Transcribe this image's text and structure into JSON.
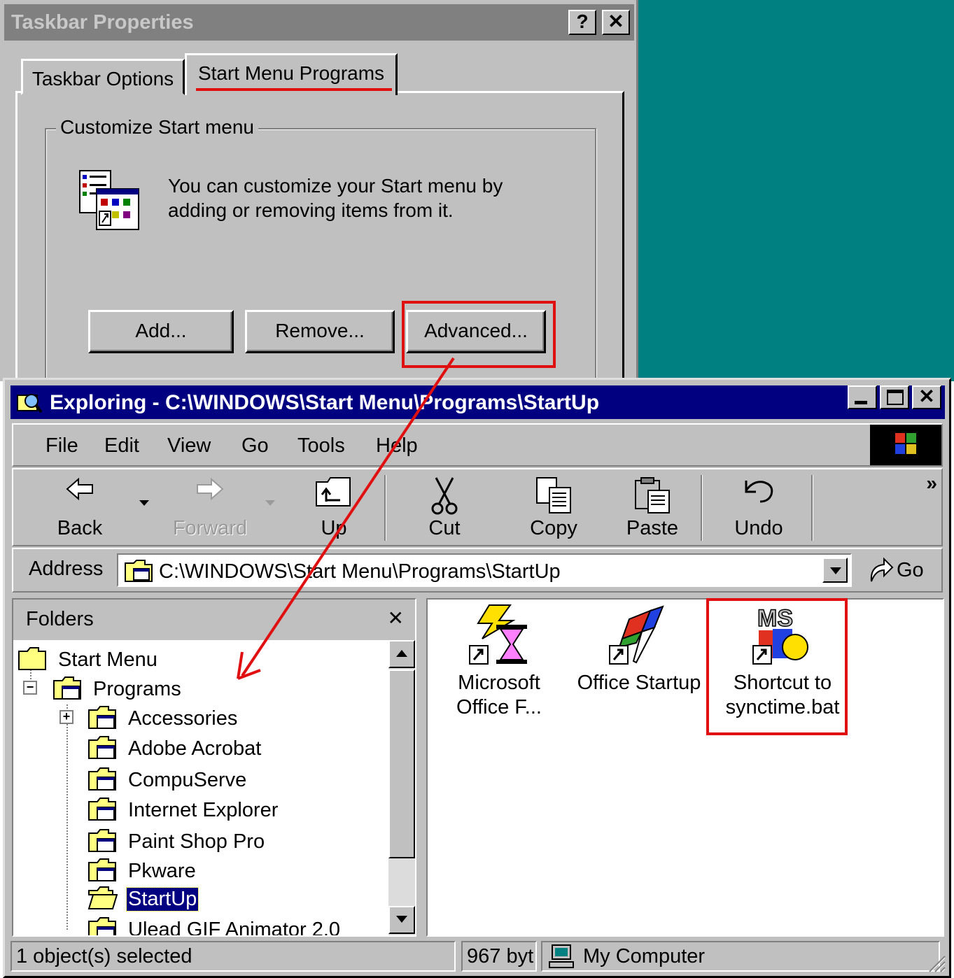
{
  "taskbar_dialog": {
    "title": "Taskbar Properties",
    "help_btn": "?",
    "close_btn": "✕",
    "tabs": [
      {
        "label": "Taskbar Options"
      },
      {
        "label": "Start Menu Programs"
      }
    ],
    "group_title": "Customize Start menu",
    "description": "You can customize your Start menu by adding or removing items from it.",
    "buttons": {
      "add": "Add...",
      "remove": "Remove...",
      "advanced": "Advanced..."
    }
  },
  "explorer": {
    "title": "Exploring - C:\\WINDOWS\\Start Menu\\Programs\\StartUp",
    "menu": [
      "File",
      "Edit",
      "View",
      "Go",
      "Tools",
      "Help"
    ],
    "toolbar": {
      "back": "Back",
      "forward": "Forward",
      "up": "Up",
      "cut": "Cut",
      "copy": "Copy",
      "paste": "Paste",
      "undo": "Undo",
      "more": "»"
    },
    "address": {
      "label": "Address",
      "value": "C:\\WINDOWS\\Start Menu\\Programs\\StartUp",
      "go": "Go"
    },
    "folders": {
      "title": "Folders",
      "close": "✕",
      "tree": [
        {
          "label": "Start Menu"
        },
        {
          "label": "Programs"
        },
        {
          "label": "Accessories"
        },
        {
          "label": "Adobe Acrobat"
        },
        {
          "label": "CompuServe"
        },
        {
          "label": "Internet Explorer"
        },
        {
          "label": "Paint Shop Pro"
        },
        {
          "label": "Pkware"
        },
        {
          "label": "StartUp"
        },
        {
          "label": "Ulead GIF Animator 2.0"
        }
      ]
    },
    "files": [
      {
        "line1": "Microsoft",
        "line2": "Office F..."
      },
      {
        "line1": "Office Startup",
        "line2": ""
      },
      {
        "line1": "Shortcut to",
        "line2": "synctime.bat"
      }
    ],
    "status": {
      "selected": "1 object(s) selected",
      "size": "967 byt",
      "location": "My Computer"
    }
  },
  "colors": {
    "annotation": "#e01010",
    "title_active": "#000080",
    "desktop": "#008080"
  },
  "icons": [
    "help-icon",
    "close-icon",
    "start-menu-icon",
    "back-icon",
    "forward-icon",
    "up-icon",
    "cut-icon",
    "copy-icon",
    "paste-icon",
    "undo-icon",
    "windows-logo-icon",
    "folder-icon",
    "go-icon",
    "computer-icon"
  ]
}
